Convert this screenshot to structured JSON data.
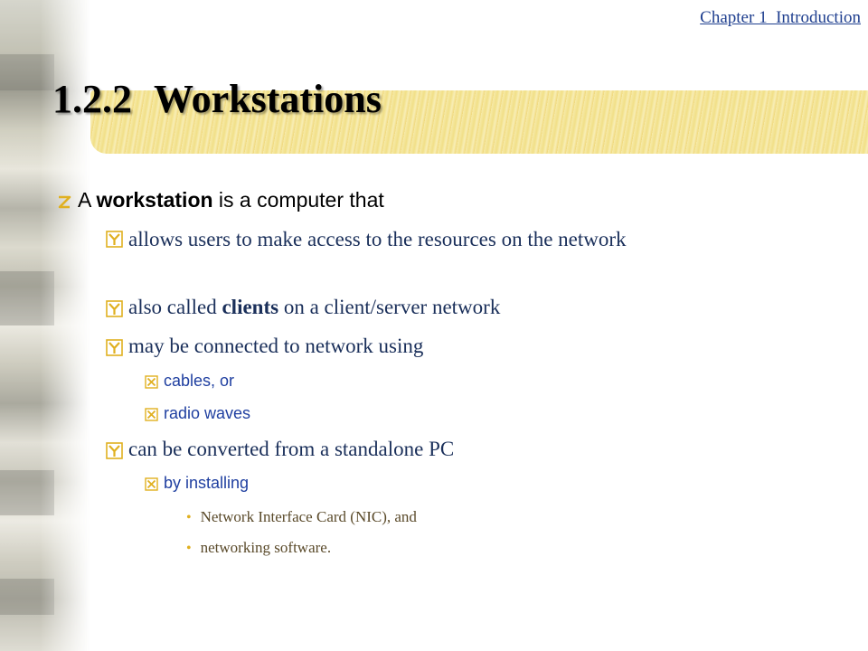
{
  "header": {
    "chapter_link": "Chapter 1  Introduction"
  },
  "slide": {
    "title_number": "1.2.2",
    "title_text": "Workstations"
  },
  "bullets": {
    "intro_prefix": "A ",
    "intro_bold": "workstation",
    "intro_suffix": " is a computer that",
    "b1": "allows users to make access to the resources on the network",
    "b2_prefix": "also called ",
    "b2_bold": "clients",
    "b2_suffix": " on a client/server network",
    "b3": "may be connected to network using",
    "b3_sub1": "cables, or",
    "b3_sub2": "radio waves",
    "b4": "can be converted from a standalone PC",
    "b4_sub1": "by installing",
    "b4_sub1_item1": "Network Interface Card (NIC), and",
    "b4_sub1_item2": "networking software."
  },
  "colors": {
    "accent_gold": "#e0b020",
    "link_blue": "#1f3f8f",
    "title_bar": "#f0dc7a"
  },
  "icons": {
    "level1": "z-bullet-icon",
    "level2": "y-checkbox-icon",
    "level3": "x-checkbox-icon",
    "level4": "dot-bullet-icon"
  }
}
